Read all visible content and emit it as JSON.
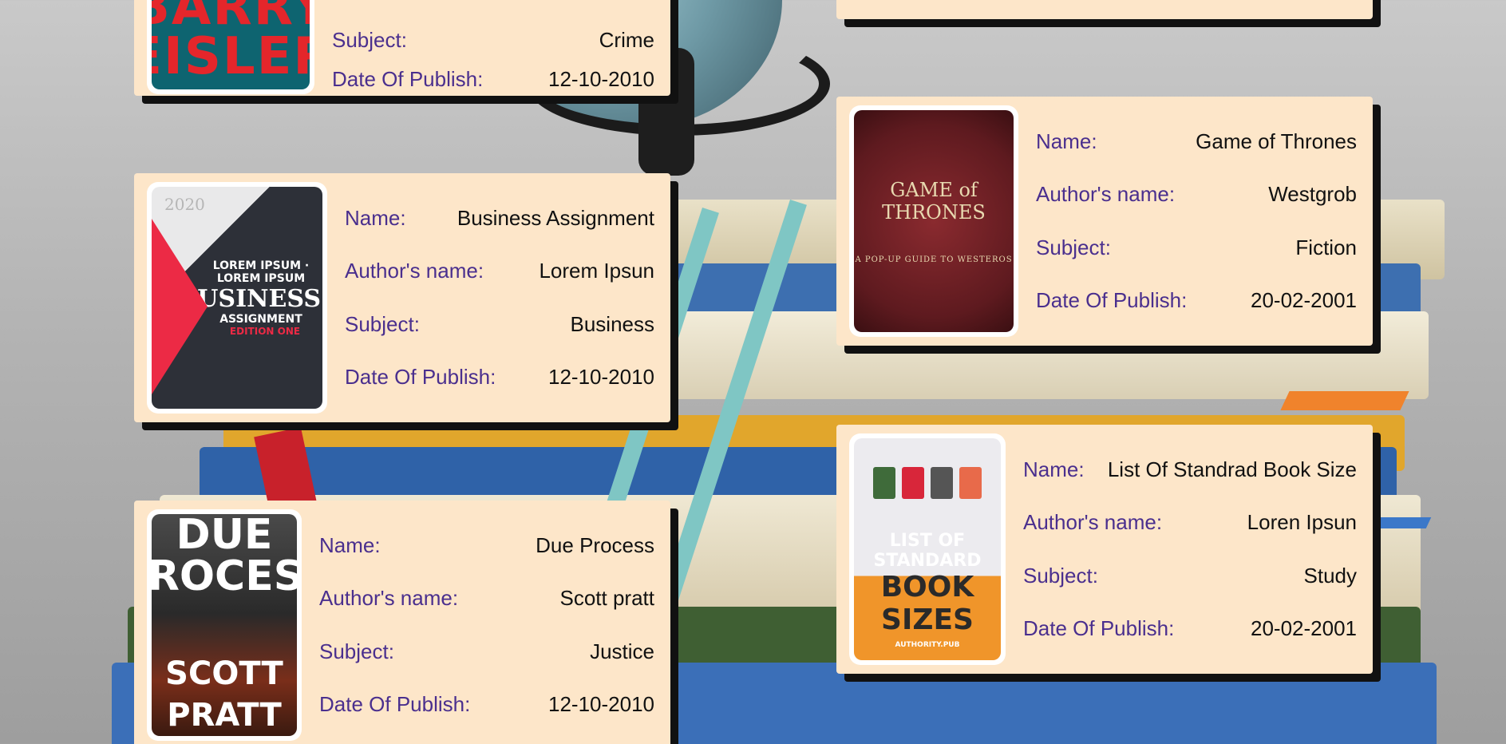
{
  "cards": [
    {
      "cover": {
        "line1": "BARRY",
        "line2": "EISLER",
        "color": "#0e6470"
      },
      "fields": [
        {
          "label": "Subject:",
          "value": "Crime"
        },
        {
          "label": "Date Of Publish:",
          "value": "12-10-2010"
        }
      ]
    },
    {
      "cover": {
        "year": "2020",
        "line1": "LOREM IPSUM · LOREM IPSUM",
        "line2": "BUSINESS",
        "line3": "ASSIGNMENT",
        "line4": "EDITION ONE",
        "color": "#2d3038"
      },
      "fields": [
        {
          "label": "Name:",
          "value": "Business Assignment"
        },
        {
          "label": "Author's name:",
          "value": "Lorem Ipsun"
        },
        {
          "label": "Subject:",
          "value": "Business"
        },
        {
          "label": "Date Of Publish:",
          "value": "12-10-2010"
        }
      ]
    },
    {
      "cover": {
        "line1": "DUE",
        "line2": "PROCESS",
        "line3": "SCOTT PRATT",
        "color": "#2a2a2a"
      },
      "fields": [
        {
          "label": "Name:",
          "value": "Due Process"
        },
        {
          "label": "Author's name:",
          "value": "Scott pratt"
        },
        {
          "label": "Subject:",
          "value": "Justice"
        },
        {
          "label": "Date Of Publish:",
          "value": "12-10-2010"
        }
      ]
    },
    {
      "cover": {
        "line1": "GAME of THRONES",
        "line2": "A POP-UP GUIDE TO WESTEROS",
        "color": "#5e1a1f"
      },
      "fields": [
        {
          "label": "Name:",
          "value": "Game of Thrones"
        },
        {
          "label": "Author's name:",
          "value": "Westgrob"
        },
        {
          "label": "Subject:",
          "value": "Fiction"
        },
        {
          "label": "Date Of Publish:",
          "value": "20-02-2001"
        }
      ]
    },
    {
      "cover": {
        "line1": "LIST OF STANDARD",
        "line2": "BOOK SIZES",
        "line3": "AUTHORITY.PUB",
        "color": "#f0952a"
      },
      "fields": [
        {
          "label": "Name:",
          "value": "List Of Standrad Book Size"
        },
        {
          "label": "Author's name:",
          "value": "Loren Ipsun"
        },
        {
          "label": "Subject:",
          "value": "Study"
        },
        {
          "label": "Date Of Publish:",
          "value": "20-02-2001"
        }
      ]
    }
  ]
}
